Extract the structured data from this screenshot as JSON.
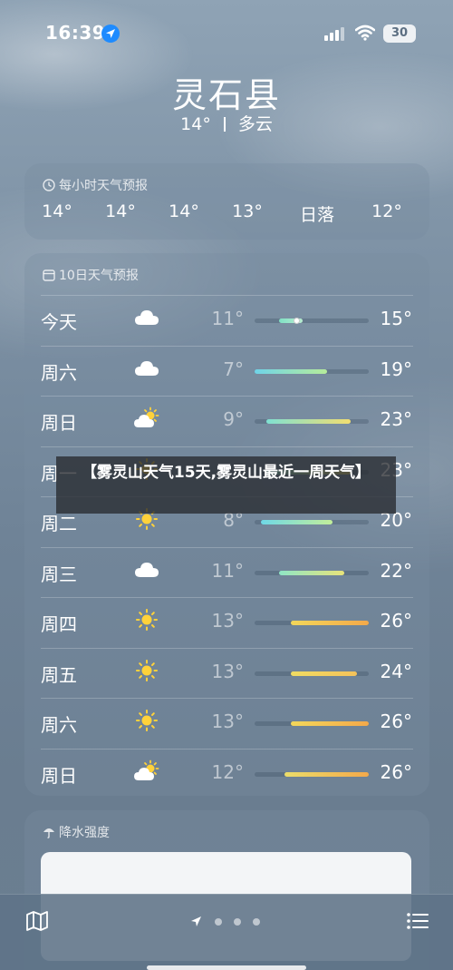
{
  "status_bar": {
    "time": "16:39",
    "battery": "30"
  },
  "header": {
    "city": "灵石县",
    "temperature": "14°",
    "condition": "多云"
  },
  "hourly": {
    "title": "每小时天气预报",
    "items": [
      "14°",
      "14°",
      "14°",
      "13°",
      "日落",
      "12°"
    ]
  },
  "daily": {
    "title": "10日天气预报",
    "range_min": 7,
    "range_max": 26,
    "current_temp": 14,
    "days": [
      {
        "name": "今天",
        "icon": "cloud-icon",
        "low": "11°",
        "high": "15°",
        "low_val": 11,
        "high_val": 15,
        "colors": [
          "#7fe0c4",
          "#b8ecd0"
        ]
      },
      {
        "name": "周六",
        "icon": "cloud-icon",
        "low": "7°",
        "high": "19°",
        "low_val": 7,
        "high_val": 19,
        "colors": [
          "#6fd3e8",
          "#b6ec9a"
        ]
      },
      {
        "name": "周日",
        "icon": "partly-sunny-icon",
        "low": "9°",
        "high": "23°",
        "low_val": 9,
        "high_val": 23,
        "colors": [
          "#7fe0d2",
          "#f2de70"
        ]
      },
      {
        "name": "周一",
        "icon": "sun-icon",
        "low": "",
        "high": "23°",
        "low_val": 9,
        "high_val": 23,
        "colors": [
          "#7fe0d2",
          "#f2de70"
        ]
      },
      {
        "name": "周二",
        "icon": "sun-icon",
        "low": "8°",
        "high": "20°",
        "low_val": 8,
        "high_val": 20,
        "colors": [
          "#6fd8e6",
          "#c2ee9a"
        ]
      },
      {
        "name": "周三",
        "icon": "cloud-icon",
        "low": "11°",
        "high": "22°",
        "low_val": 11,
        "high_val": 22,
        "colors": [
          "#8fe6c6",
          "#e8e47a"
        ]
      },
      {
        "name": "周四",
        "icon": "sun-icon",
        "low": "13°",
        "high": "26°",
        "low_val": 13,
        "high_val": 26,
        "colors": [
          "#f3d75a",
          "#f4a94a"
        ]
      },
      {
        "name": "周五",
        "icon": "sun-icon",
        "low": "13°",
        "high": "24°",
        "low_val": 13,
        "high_val": 24,
        "colors": [
          "#f0dc62",
          "#f4c25a"
        ]
      },
      {
        "name": "周六",
        "icon": "sun-icon",
        "low": "13°",
        "high": "26°",
        "low_val": 13,
        "high_val": 26,
        "colors": [
          "#f3d75a",
          "#f4a94a"
        ]
      },
      {
        "name": "周日",
        "icon": "partly-sunny-icon",
        "low": "12°",
        "high": "26°",
        "low_val": 12,
        "high_val": 26,
        "colors": [
          "#ecdd6a",
          "#f4a94a"
        ]
      }
    ]
  },
  "precipitation": {
    "title": "降水强度"
  },
  "banner": {
    "text": "【雾灵山天气15天,雾灵山最近一周天气】"
  },
  "bottom_bar": {
    "icons": [
      "map-icon",
      "location-arrow-icon",
      "list-icon"
    ],
    "page_count": 4
  }
}
